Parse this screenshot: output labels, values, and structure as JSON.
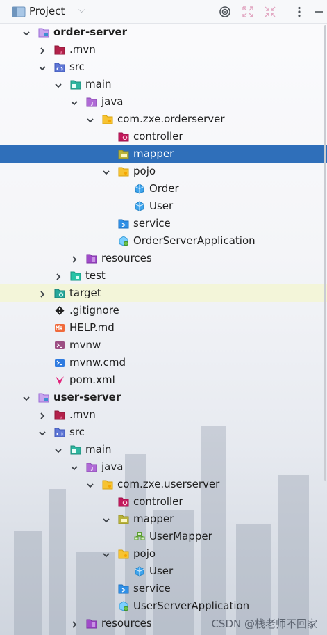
{
  "header": {
    "title": "Project"
  },
  "tree": [
    {
      "label": "order-server",
      "depth": 0,
      "expand": "open",
      "icon": "module-folder",
      "bold": true
    },
    {
      "label": ".mvn",
      "depth": 1,
      "expand": "closed",
      "icon": "mvn-folder"
    },
    {
      "label": "src",
      "depth": 1,
      "expand": "open",
      "icon": "src-folder"
    },
    {
      "label": "main",
      "depth": 2,
      "expand": "open",
      "icon": "main-folder"
    },
    {
      "label": "java",
      "depth": 3,
      "expand": "open",
      "icon": "java-folder"
    },
    {
      "label": "com.zxe.orderserver",
      "depth": 4,
      "expand": "open",
      "icon": "package-folder"
    },
    {
      "label": "controller",
      "depth": 5,
      "expand": "none",
      "icon": "controller-folder"
    },
    {
      "label": "mapper",
      "depth": 5,
      "expand": "none",
      "icon": "mapper-folder",
      "selected": true
    },
    {
      "label": "pojo",
      "depth": 5,
      "expand": "open",
      "icon": "package-folder"
    },
    {
      "label": "Order",
      "depth": 6,
      "expand": "none",
      "icon": "class-file"
    },
    {
      "label": "User",
      "depth": 6,
      "expand": "none",
      "icon": "class-file"
    },
    {
      "label": "service",
      "depth": 5,
      "expand": "none",
      "icon": "service-folder"
    },
    {
      "label": "OrderServerApplication",
      "depth": 5,
      "expand": "none",
      "icon": "spring-app-file"
    },
    {
      "label": "resources",
      "depth": 3,
      "expand": "closed",
      "icon": "resources-folder"
    },
    {
      "label": "test",
      "depth": 2,
      "expand": "closed",
      "icon": "test-folder"
    },
    {
      "label": "target",
      "depth": 1,
      "expand": "closed",
      "icon": "target-folder",
      "highlight": true
    },
    {
      "label": ".gitignore",
      "depth": 1,
      "expand": "none",
      "icon": "git-file"
    },
    {
      "label": "HELP.md",
      "depth": 1,
      "expand": "none",
      "icon": "markdown-file"
    },
    {
      "label": "mvnw",
      "depth": 1,
      "expand": "none",
      "icon": "shell-file"
    },
    {
      "label": "mvnw.cmd",
      "depth": 1,
      "expand": "none",
      "icon": "cmd-file"
    },
    {
      "label": "pom.xml",
      "depth": 1,
      "expand": "none",
      "icon": "maven-file"
    },
    {
      "label": "user-server",
      "depth": 0,
      "expand": "open",
      "icon": "module-folder",
      "bold": true
    },
    {
      "label": ".mvn",
      "depth": 1,
      "expand": "closed",
      "icon": "mvn-folder"
    },
    {
      "label": "src",
      "depth": 1,
      "expand": "open",
      "icon": "src-folder"
    },
    {
      "label": "main",
      "depth": 2,
      "expand": "open",
      "icon": "main-folder"
    },
    {
      "label": "java",
      "depth": 3,
      "expand": "open",
      "icon": "java-folder"
    },
    {
      "label": "com.zxe.userserver",
      "depth": 4,
      "expand": "open",
      "icon": "package-folder"
    },
    {
      "label": "controller",
      "depth": 5,
      "expand": "none",
      "icon": "controller-folder"
    },
    {
      "label": "mapper",
      "depth": 5,
      "expand": "open",
      "icon": "mapper-folder"
    },
    {
      "label": "UserMapper",
      "depth": 6,
      "expand": "none",
      "icon": "mapper-interface-file"
    },
    {
      "label": "pojo",
      "depth": 5,
      "expand": "open",
      "icon": "package-folder"
    },
    {
      "label": "User",
      "depth": 6,
      "expand": "none",
      "icon": "class-file"
    },
    {
      "label": "service",
      "depth": 5,
      "expand": "none",
      "icon": "service-folder"
    },
    {
      "label": "UserServerApplication",
      "depth": 5,
      "expand": "none",
      "icon": "spring-app-file"
    },
    {
      "label": "resources",
      "depth": 3,
      "expand": "closed",
      "icon": "resources-folder"
    }
  ],
  "watermark": "CSDN @栈老师不回家",
  "colors": {
    "selection": "#2f6fba",
    "highlight": "#f3f5d9",
    "package": "#f2b718",
    "module": "#9b6bd6"
  }
}
